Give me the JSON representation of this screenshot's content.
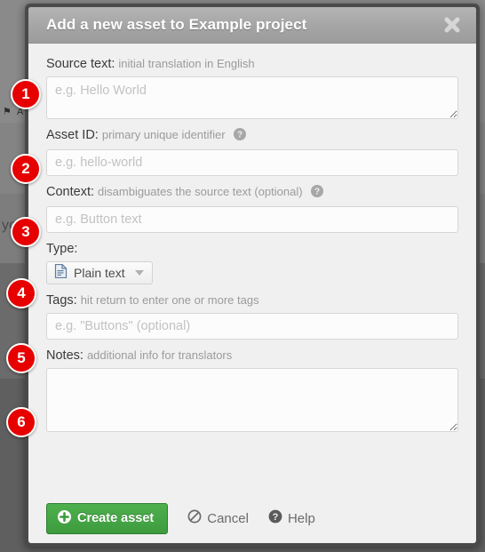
{
  "background": {
    "flag_icon": "flag-icon",
    "partial_label": "A",
    "partial_text": "yo"
  },
  "modal": {
    "title": "Add a new asset to Example project",
    "close_icon": "close-icon",
    "fields": {
      "source_text": {
        "label": "Source text:",
        "hint": "initial translation in English",
        "placeholder": "e.g. Hello World",
        "value": ""
      },
      "asset_id": {
        "label": "Asset ID:",
        "hint": "primary unique identifier",
        "help_icon": "help-circle-icon",
        "placeholder": "e.g. hello-world",
        "value": ""
      },
      "context": {
        "label": "Context:",
        "hint": "disambiguates the source text (optional)",
        "help_icon": "help-circle-icon",
        "placeholder": "e.g. Button text",
        "value": ""
      },
      "type": {
        "label": "Type:",
        "selected": "Plain text",
        "icon": "file-text-icon",
        "caret_icon": "chevron-down-icon"
      },
      "tags": {
        "label": "Tags:",
        "hint": "hit return to enter one or more tags",
        "placeholder": "e.g. \"Buttons\" (optional)",
        "value": ""
      },
      "notes": {
        "label": "Notes:",
        "hint": "additional info for translators",
        "placeholder": "",
        "value": ""
      }
    },
    "footer": {
      "create_label": "Create asset",
      "create_icon": "plus-circle-icon",
      "cancel_label": "Cancel",
      "cancel_icon": "ban-icon",
      "help_label": "Help",
      "help_icon": "help-circle-icon"
    }
  },
  "badges": [
    {
      "number": "1"
    },
    {
      "number": "2"
    },
    {
      "number": "3"
    },
    {
      "number": "4"
    },
    {
      "number": "5"
    },
    {
      "number": "6"
    }
  ],
  "colors": {
    "badge_red": "#e60000",
    "create_green": "#3d9b3d",
    "header_gray": "#a5a5a5",
    "hint_gray": "#9b9b9b"
  }
}
